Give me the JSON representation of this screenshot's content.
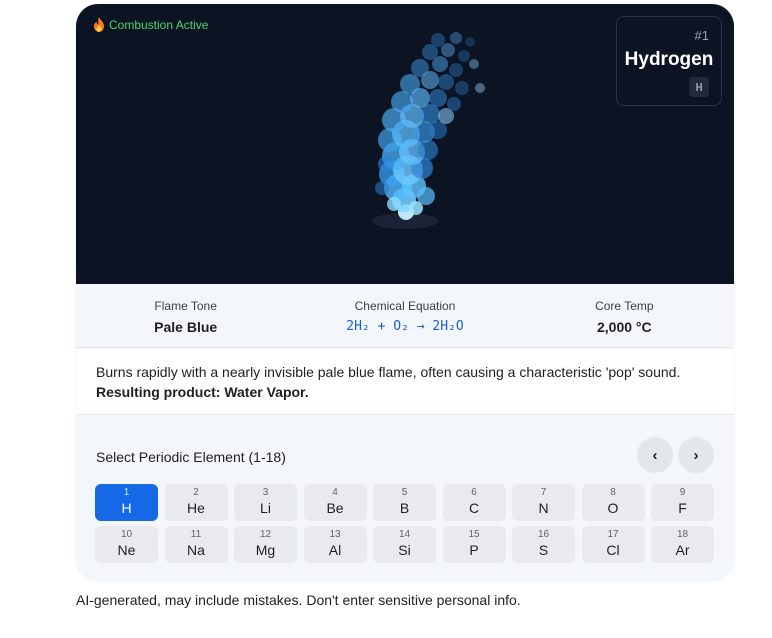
{
  "status": {
    "text": "Combustion Active",
    "icon": "fire-icon",
    "color": "#4ad66d"
  },
  "element": {
    "number": "#1",
    "name": "Hydrogen",
    "symbol": "H"
  },
  "flame": {
    "color": "#5ab8ff"
  },
  "stats": [
    {
      "label": "Flame Tone",
      "value": "Pale Blue"
    },
    {
      "label": "Chemical Equation",
      "value": "2H₂ + O₂ → 2H₂O"
    },
    {
      "label": "Core Temp",
      "value": "2,000 °C"
    }
  ],
  "description": {
    "text": "Burns rapidly with a nearly invisible pale blue flame, often causing a characteristic 'pop' sound.",
    "product": "Resulting product: Water Vapor."
  },
  "selector": {
    "title": "Select Periodic Element (1-18)",
    "prev_label": "‹",
    "next_label": "›",
    "accent": "#1669e6",
    "elements": [
      {
        "n": "1",
        "s": "H"
      },
      {
        "n": "2",
        "s": "He"
      },
      {
        "n": "3",
        "s": "Li"
      },
      {
        "n": "4",
        "s": "Be"
      },
      {
        "n": "5",
        "s": "B"
      },
      {
        "n": "6",
        "s": "C"
      },
      {
        "n": "7",
        "s": "N"
      },
      {
        "n": "8",
        "s": "O"
      },
      {
        "n": "9",
        "s": "F"
      },
      {
        "n": "10",
        "s": "Ne"
      },
      {
        "n": "11",
        "s": "Na"
      },
      {
        "n": "12",
        "s": "Mg"
      },
      {
        "n": "13",
        "s": "Al"
      },
      {
        "n": "14",
        "s": "Si"
      },
      {
        "n": "15",
        "s": "P"
      },
      {
        "n": "16",
        "s": "S"
      },
      {
        "n": "17",
        "s": "Cl"
      },
      {
        "n": "18",
        "s": "Ar"
      }
    ],
    "selected": "H"
  },
  "footer": {
    "text": "AI-generated, may include mistakes. Don't enter sensitive personal info."
  }
}
